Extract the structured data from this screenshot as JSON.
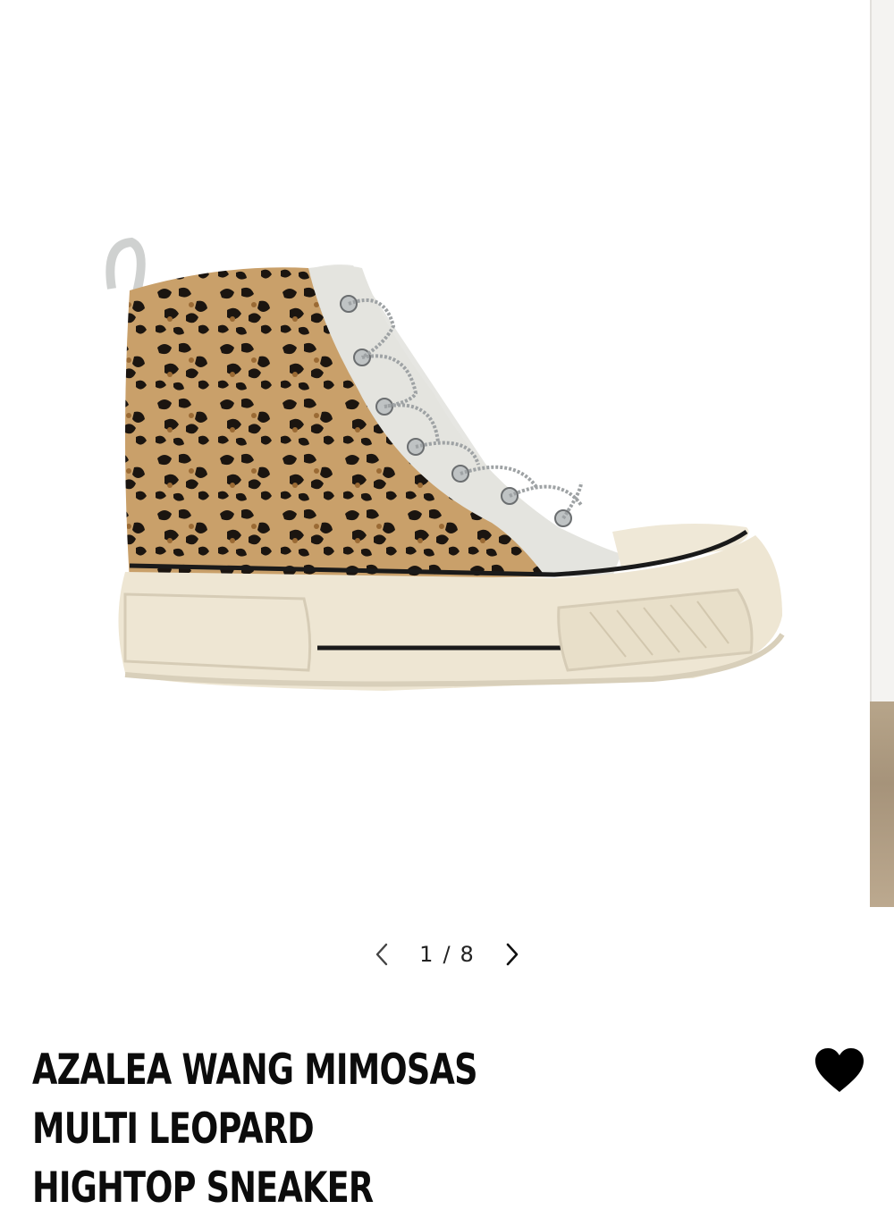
{
  "gallery": {
    "current_page": "1",
    "separator": "/",
    "total_pages": "8",
    "image_alt": "Azalea Wang Mimosas Multi Leopard Hightop Sneaker"
  },
  "icons": {
    "prev": "chevron-left-icon",
    "next": "chevron-right-icon",
    "favorite": "heart-icon"
  },
  "product": {
    "title_line1": "AZALEA WANG MIMOSAS MULTI LEOPARD",
    "title_line2": "HIGHTOP SNEAKER"
  },
  "colors": {
    "heart": "#000000",
    "background": "#ffffff"
  }
}
